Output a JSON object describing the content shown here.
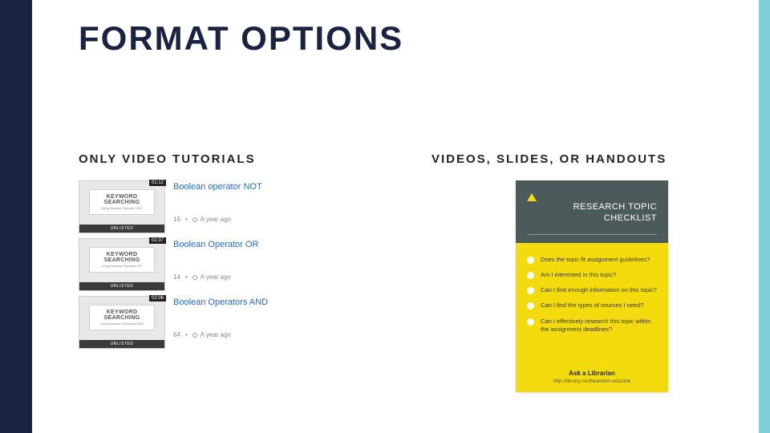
{
  "title": "FORMAT OPTIONS",
  "left": {
    "heading": "ONLY VIDEO TUTORIALS",
    "thumb_title": "KEYWORD SEARCHING",
    "thumb_badge": "UNLISTED",
    "items": [
      {
        "title": "Boolean operator NOT",
        "duration": "01:12",
        "subtitle": "Using Boolean Operator NOT",
        "views": "16",
        "age": "A year ago"
      },
      {
        "title": "Boolean Operator OR",
        "duration": "02:37",
        "subtitle": "Using Boolean Operator OR",
        "views": "14",
        "age": "A year ago"
      },
      {
        "title": "Boolean Operators AND",
        "duration": "02:06",
        "subtitle": "Using Boolean Operators AND",
        "views": "64",
        "age": "A year ago"
      }
    ]
  },
  "right": {
    "heading": "VIDEOS, SLIDES, OR HANDOUTS",
    "card": {
      "title_line1": "RESEARCH TOPIC",
      "title_line2": "CHECKLIST",
      "items": [
        "Does the topic fit assignment guidelines?",
        "Am I interested in this topic?",
        "Can I find enough information on this topic?",
        "Can I find the types of sources I need?",
        "Can I effectively research this topic within the assignment deadlines?"
      ],
      "footer_title": "Ask a Librarian",
      "footer_url": "http://library.northeastern.edu/ask"
    }
  }
}
